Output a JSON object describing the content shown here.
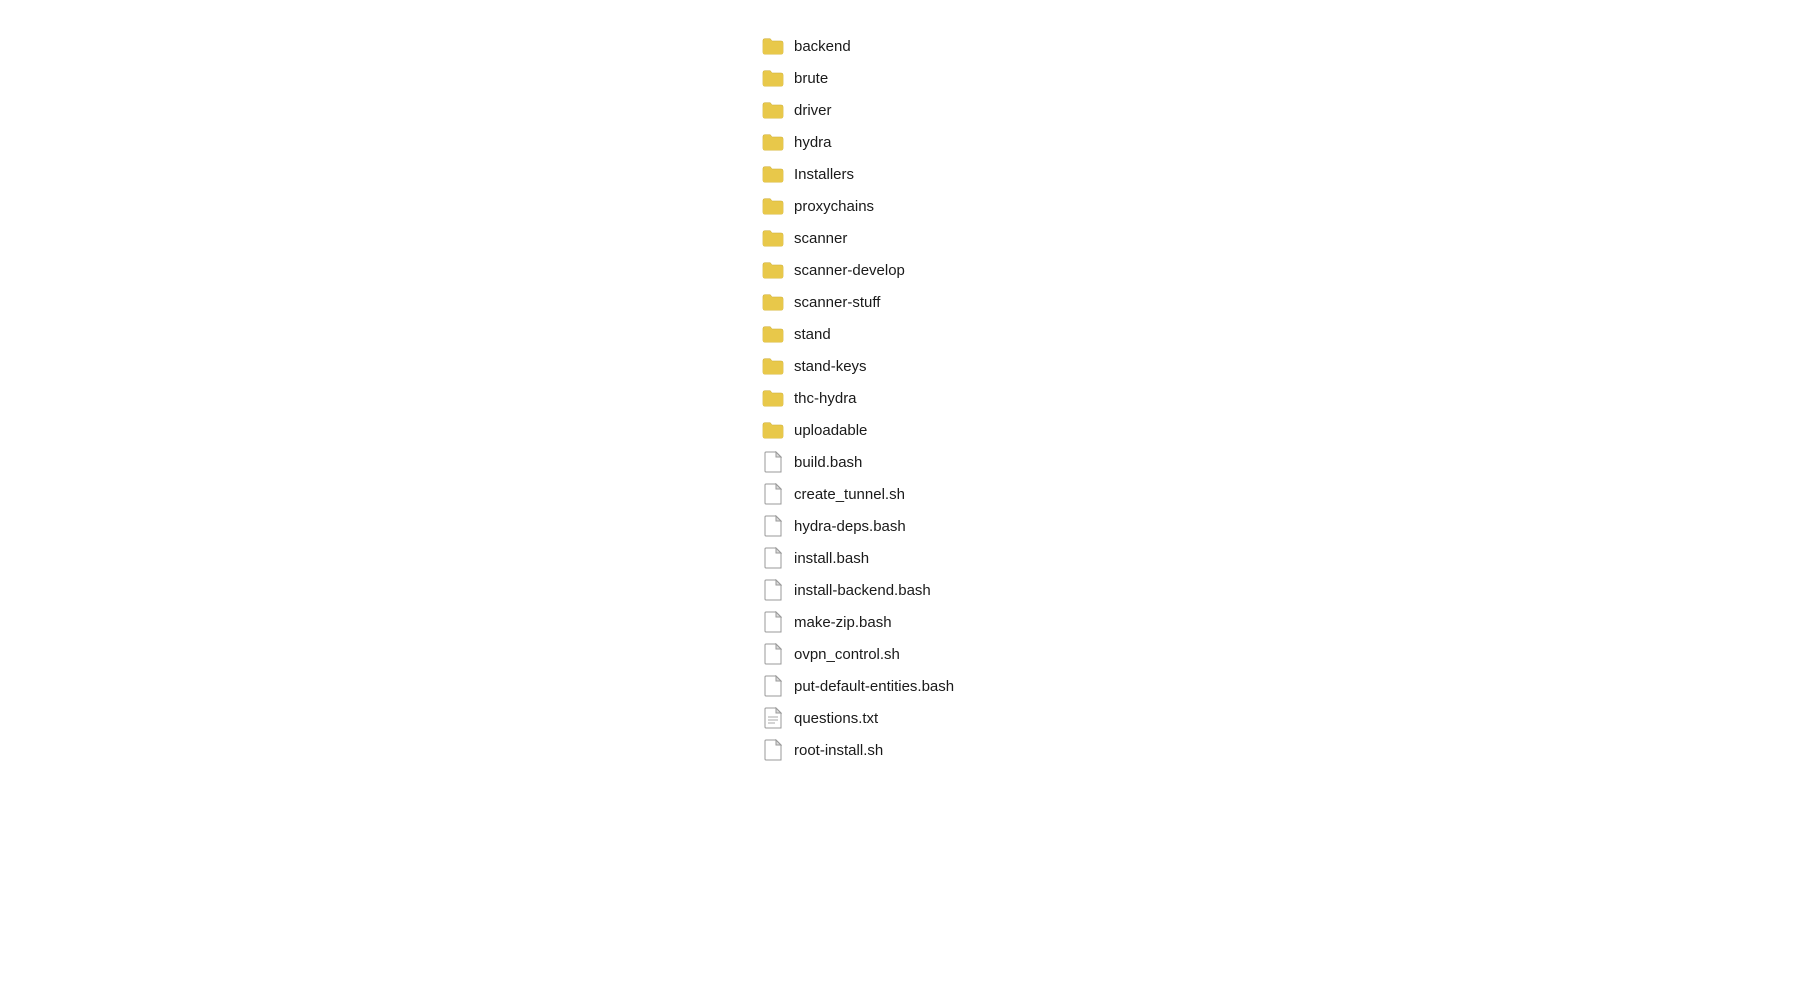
{
  "items": [
    {
      "name": "backend",
      "type": "folder"
    },
    {
      "name": "brute",
      "type": "folder"
    },
    {
      "name": "driver",
      "type": "folder"
    },
    {
      "name": "hydra",
      "type": "folder"
    },
    {
      "name": "Installers",
      "type": "folder"
    },
    {
      "name": "proxychains",
      "type": "folder"
    },
    {
      "name": "scanner",
      "type": "folder"
    },
    {
      "name": "scanner-develop",
      "type": "folder"
    },
    {
      "name": "scanner-stuff",
      "type": "folder"
    },
    {
      "name": "stand",
      "type": "folder"
    },
    {
      "name": "stand-keys",
      "type": "folder"
    },
    {
      "name": "thc-hydra",
      "type": "folder"
    },
    {
      "name": "uploadable",
      "type": "folder"
    },
    {
      "name": "build.bash",
      "type": "file"
    },
    {
      "name": "create_tunnel.sh",
      "type": "file"
    },
    {
      "name": "hydra-deps.bash",
      "type": "file"
    },
    {
      "name": "install.bash",
      "type": "file"
    },
    {
      "name": "install-backend.bash",
      "type": "file"
    },
    {
      "name": "make-zip.bash",
      "type": "file"
    },
    {
      "name": "ovpn_control.sh",
      "type": "file"
    },
    {
      "name": "put-default-entities.bash",
      "type": "file"
    },
    {
      "name": "questions.txt",
      "type": "file-lines"
    },
    {
      "name": "root-install.sh",
      "type": "file"
    }
  ],
  "colors": {
    "folder": "#E8C84A",
    "folder_shadow": "#C9A832",
    "file_body": "#ffffff",
    "file_border": "#888888",
    "file_lines": "#888888"
  }
}
